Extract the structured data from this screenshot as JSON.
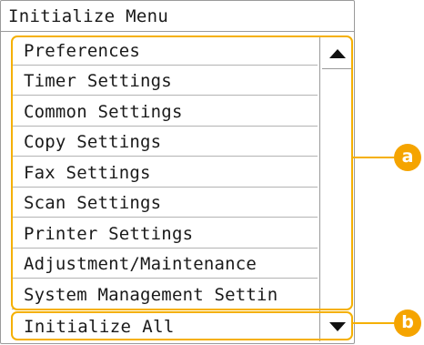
{
  "title": "Initialize Menu",
  "menu_items": [
    "Preferences",
    "Timer Settings",
    "Common Settings",
    "Copy Settings",
    "Fax Settings",
    "Scan Settings",
    "Printer Settings",
    "Adjustment/Maintenance",
    "System Management Settin"
  ],
  "bottom_label": "Initialize All",
  "callouts": {
    "a": "a",
    "b": "b"
  },
  "colors": {
    "callout": "#f5a400",
    "border": "#9a9a9a"
  },
  "icons": {
    "scroll_up": "triangle-up-icon",
    "dropdown": "triangle-down-icon"
  }
}
